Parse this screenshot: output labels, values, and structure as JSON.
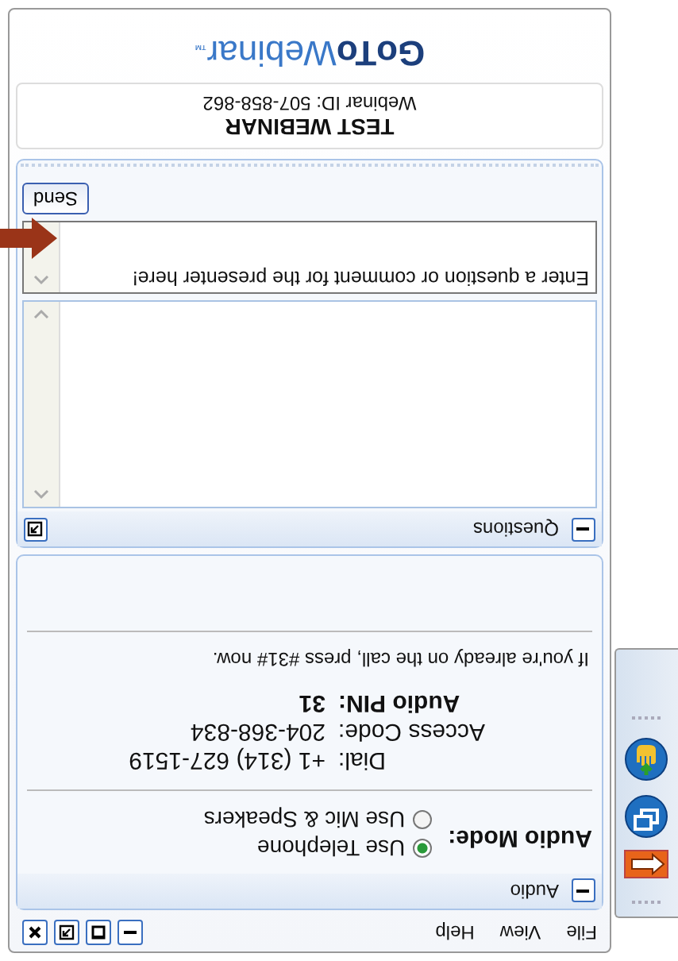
{
  "menu": [
    "File",
    "View",
    "Help"
  ],
  "window_buttons": [
    {
      "kind": "minimize"
    },
    {
      "kind": "restore"
    },
    {
      "kind": "popout"
    },
    {
      "kind": "close"
    }
  ],
  "side_toolbar": [
    {
      "kind": "arrow"
    },
    {
      "kind": "windows"
    },
    {
      "kind": "hand"
    }
  ],
  "audio": {
    "title": "Audio",
    "mode_label": "Audio Mode:",
    "modes": [
      {
        "label": "Use Telephone",
        "selected": true
      },
      {
        "label": "Use Mic & Speakers",
        "selected": false
      }
    ],
    "dial": [
      {
        "caption": "Dial:",
        "number": "+1 (314) 627-1519",
        "kind": "plain"
      },
      {
        "caption": "Access Code:",
        "number": "204-368-834",
        "kind": "plain"
      },
      {
        "caption": "Audio PIN:",
        "number": "31",
        "kind": "bold"
      }
    ],
    "note": "If you're already on the call, press #31# now."
  },
  "questions": {
    "title": "Questions",
    "placeholder": "Enter a question or comment for the presenter here!",
    "send": "Send"
  },
  "webinar": {
    "title": "TEST WEBINAR",
    "id": "Webinar ID: 507-858-862"
  },
  "logo": {
    "strong": "GoTo",
    "light": "Webinar",
    "mark": "™"
  }
}
